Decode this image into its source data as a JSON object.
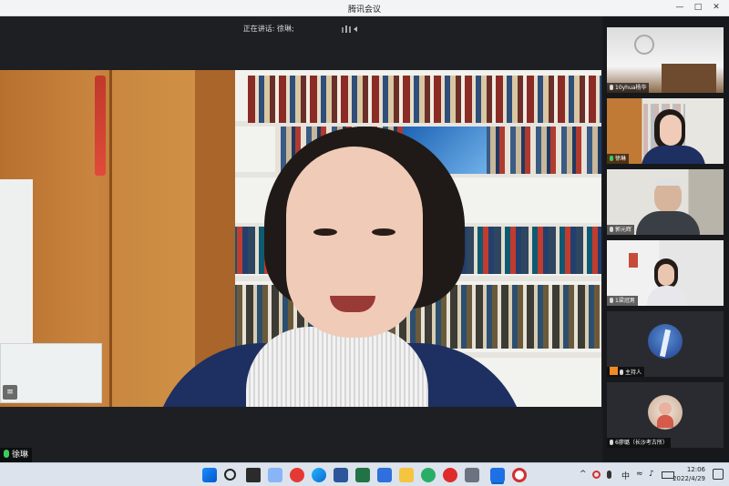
{
  "window": {
    "title": "腾讯会议",
    "min_icon": "minimize-icon",
    "max_icon": "maximize-icon",
    "close_icon": "close-icon"
  },
  "stage": {
    "speaking_label": "正在讲话: 徐琳;",
    "main_speaker_name": "徐琳"
  },
  "participants": [
    {
      "name": "10yhua杨华",
      "mic": "off"
    },
    {
      "name": "徐琳",
      "mic": "on"
    },
    {
      "name": "郭元晖",
      "mic": "off"
    },
    {
      "name": "1梁冠男",
      "mic": "off"
    },
    {
      "name": "主持人",
      "mic": "off",
      "badge": "host"
    },
    {
      "name": "6廖璐（长沙考古所）",
      "mic": "off"
    }
  ],
  "taskbar": {
    "apps": [
      "windows-start-icon",
      "search-icon",
      "task-view-icon",
      "widgets-icon",
      "app-red-icon",
      "edge-browser-icon",
      "word-icon",
      "excel-icon",
      "todo-icon",
      "files-icon",
      "wechat-icon",
      "netease-music-icon",
      "calculator-icon",
      "tencent-meeting-icon",
      "record-icon"
    ],
    "tray": {
      "caret": "^",
      "input_method": "中",
      "time": "12:06",
      "date": "2022/4/29"
    }
  },
  "colors": {
    "accent": "#0067c0",
    "speaking_green": "#3bcf5a",
    "host_orange": "#f08a24",
    "stage_bg": "#1e1f23",
    "sidebar_bg": "#17181b"
  }
}
